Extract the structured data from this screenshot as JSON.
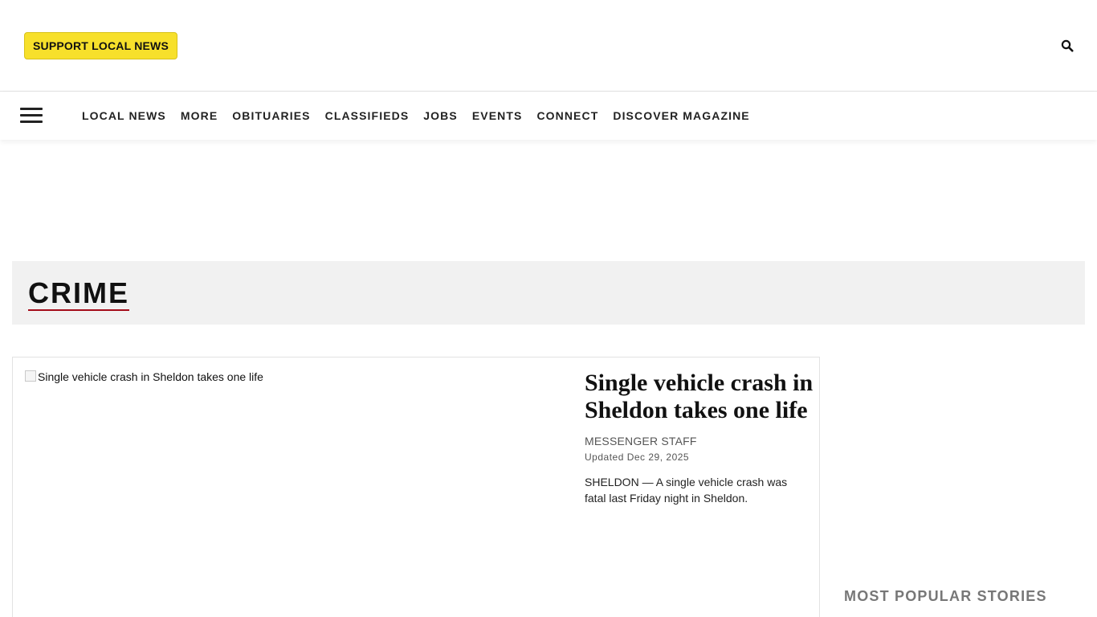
{
  "header": {
    "support_label": "SUPPORT LOCAL NEWS",
    "search_icon": "search-icon",
    "accent_color": "#f7e02b"
  },
  "nav": {
    "menu_icon": "hamburger-menu-icon",
    "items": [
      {
        "label": "LOCAL NEWS"
      },
      {
        "label": "MORE"
      },
      {
        "label": "OBITUARIES"
      },
      {
        "label": "CLASSIFIEDS"
      },
      {
        "label": "JOBS"
      },
      {
        "label": "EVENTS"
      },
      {
        "label": "CONNECT"
      },
      {
        "label": "DISCOVER MAGAZINE"
      }
    ]
  },
  "section": {
    "title": "CRIME",
    "underline_color": "#a40d1a"
  },
  "story": {
    "image_alt": "Single vehicle crash in Sheldon takes one life",
    "headline": "Single vehicle crash in Sheldon takes one life",
    "byline": "MESSENGER STAFF",
    "updated": "Updated Dec 29, 2025",
    "summary": "SHELDON — A single vehicle crash was fatal last Friday night in Sheldon."
  },
  "sidebar": {
    "most_popular_title": "MOST POPULAR STORIES"
  }
}
